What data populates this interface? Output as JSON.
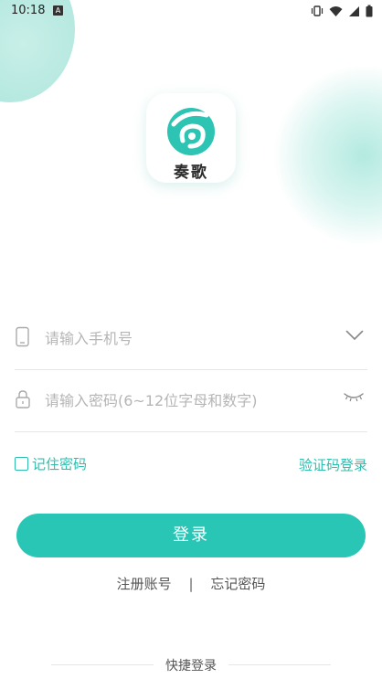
{
  "status_bar": {
    "time": "10:18",
    "a_badge": "A",
    "icons": [
      "vibrate-icon",
      "wifi-icon",
      "signal-icon",
      "battery-icon"
    ]
  },
  "app": {
    "name": "奏歌",
    "accent_color": "#29c6b6"
  },
  "form": {
    "phone_placeholder": "请输入手机号",
    "password_placeholder": "请输入密码(6~12位字母和数字)",
    "remember_label": "记住密码",
    "sms_login_label": "验证码登录",
    "login_button": "登录"
  },
  "links": {
    "register": "注册账号",
    "separator": "|",
    "forgot": "忘记密码"
  },
  "quick_login": {
    "label": "快捷登录"
  }
}
